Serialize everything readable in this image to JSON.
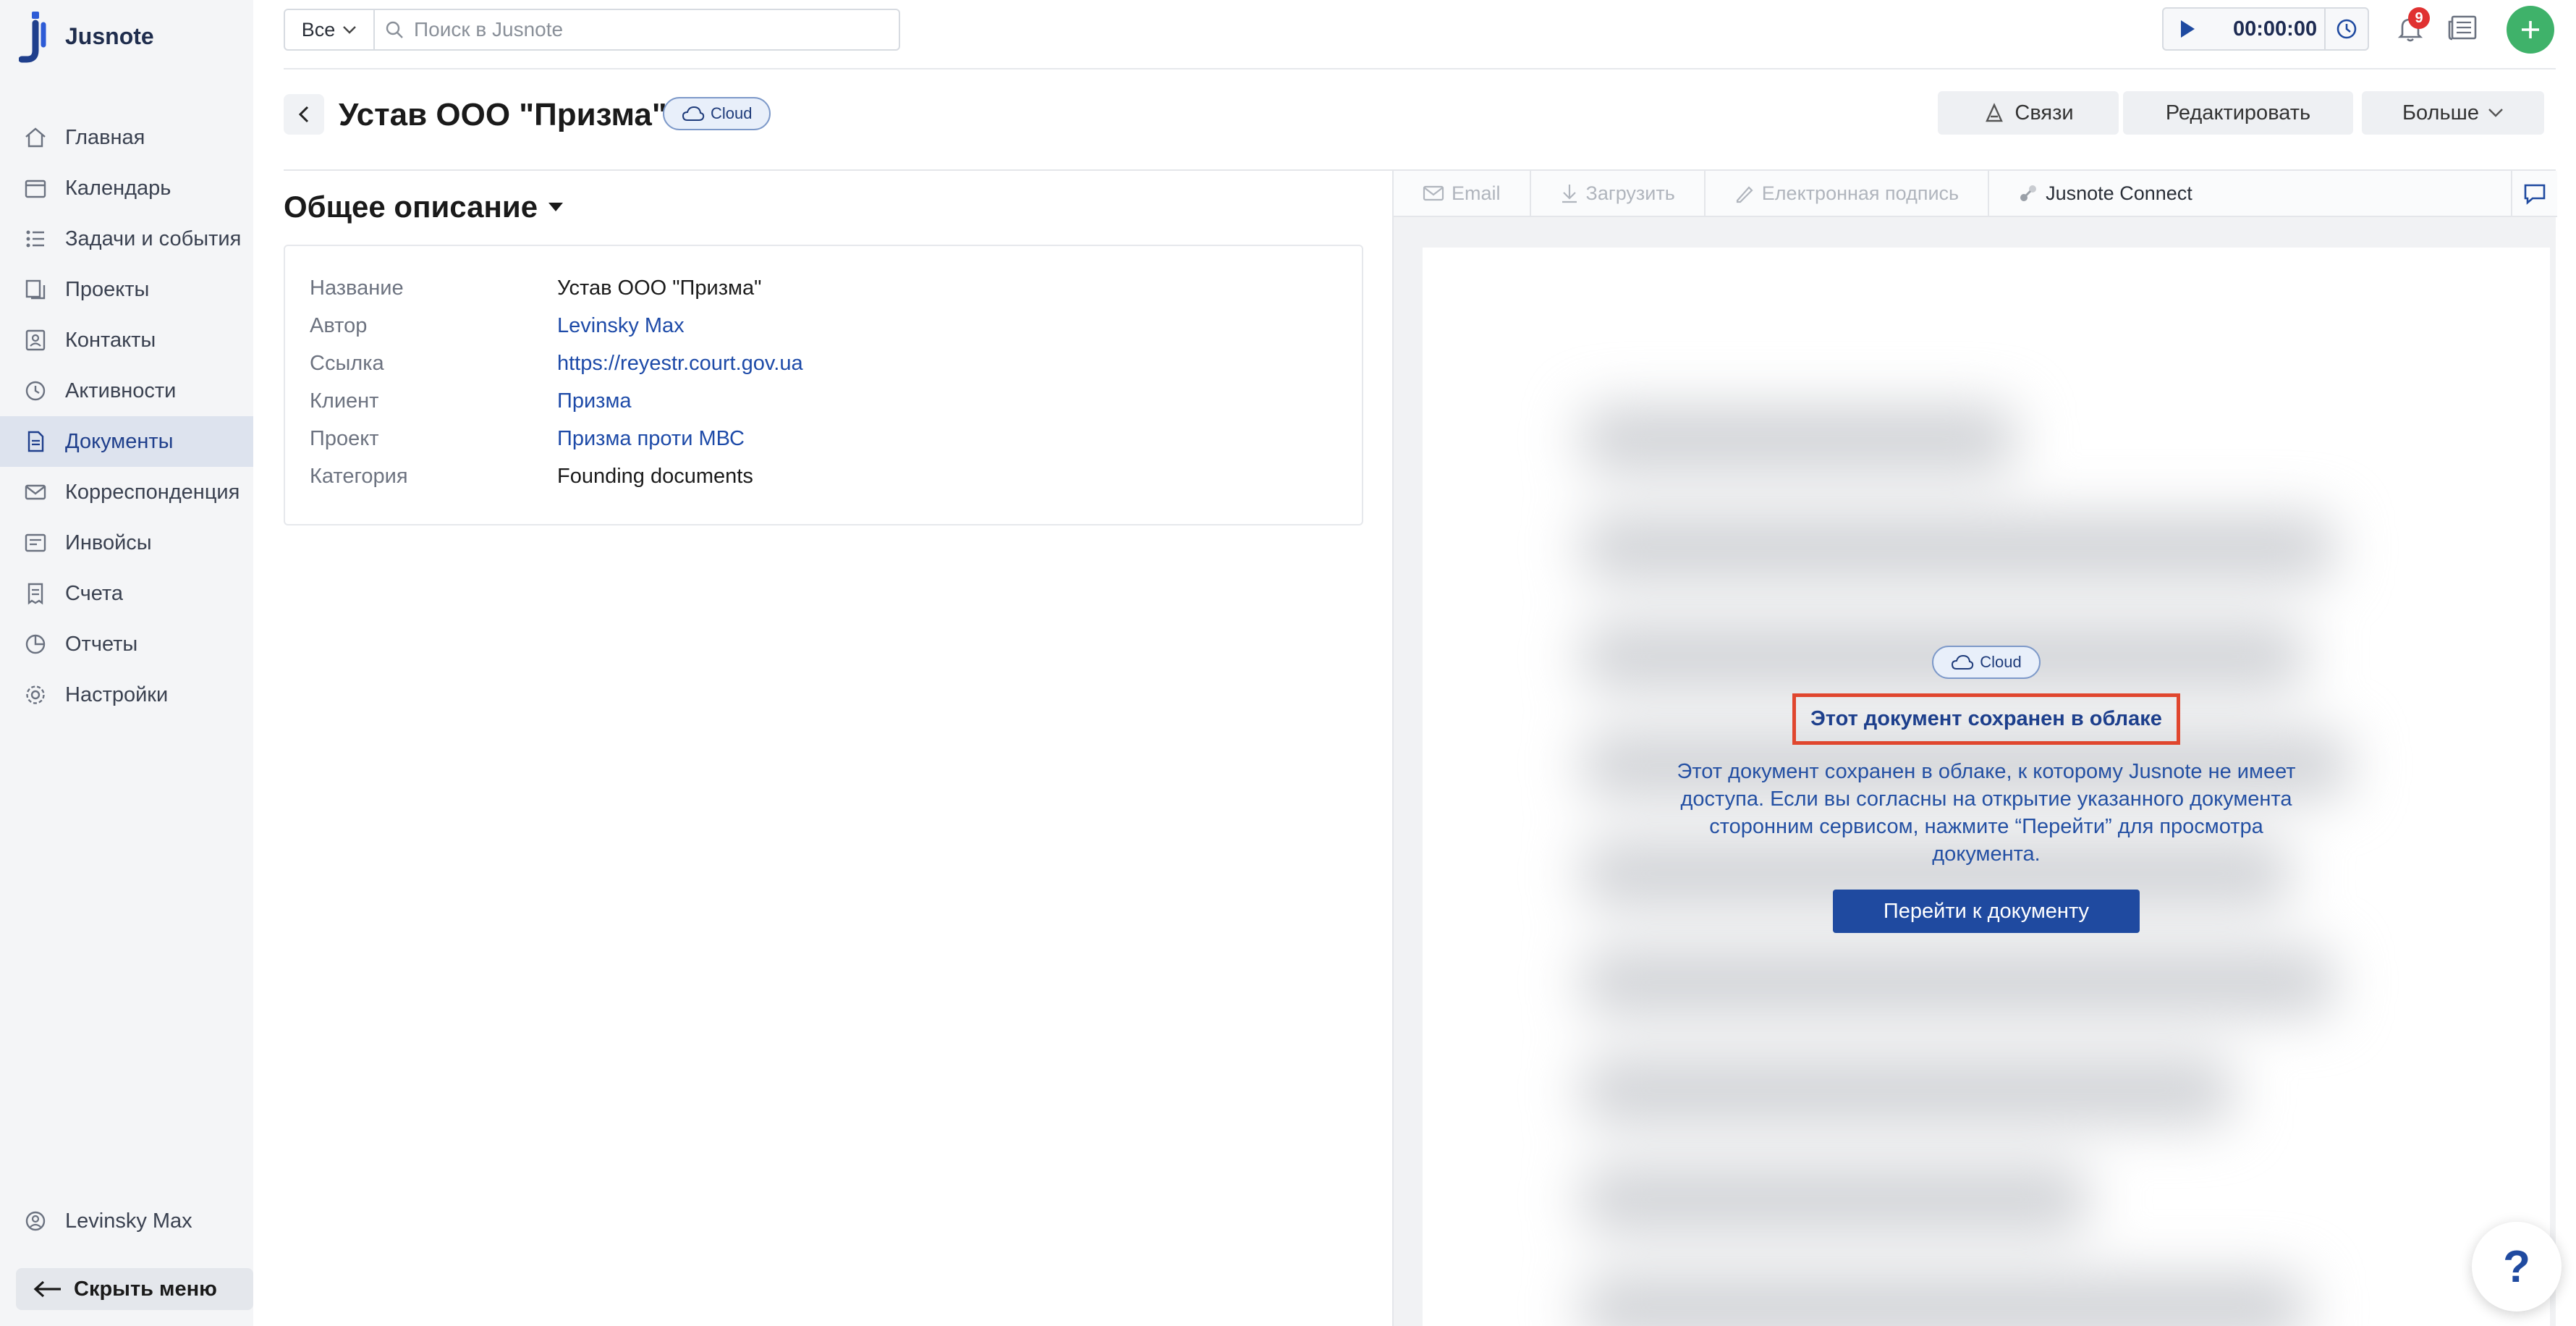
{
  "app": {
    "name": "Jusnote"
  },
  "sidebar": {
    "items": [
      {
        "label": "Главная",
        "icon": "home-icon"
      },
      {
        "label": "Календарь",
        "icon": "calendar-icon"
      },
      {
        "label": "Задачи и события",
        "icon": "tasks-icon"
      },
      {
        "label": "Проекты",
        "icon": "projects-icon"
      },
      {
        "label": "Контакты",
        "icon": "contacts-icon"
      },
      {
        "label": "Активности",
        "icon": "activity-icon"
      },
      {
        "label": "Документы",
        "icon": "documents-icon",
        "active": true
      },
      {
        "label": "Корреспонденция",
        "icon": "correspondence-icon"
      },
      {
        "label": "Инвойсы",
        "icon": "invoices-icon"
      },
      {
        "label": "Счета",
        "icon": "bills-icon"
      },
      {
        "label": "Отчеты",
        "icon": "reports-icon"
      },
      {
        "label": "Настройки",
        "icon": "settings-icon"
      }
    ],
    "user": "Levinsky Max",
    "hide_menu": "Скрыть меню"
  },
  "topbar": {
    "scope": "Все",
    "search_placeholder": "Поиск в Jusnote",
    "timer": "00:00:00",
    "notifications_count": "9"
  },
  "document": {
    "title": "Устав ООО \"Призма\"",
    "storage_badge": "Cloud",
    "actions": {
      "links": "Связи",
      "edit": "Редактировать",
      "more": "Больше"
    }
  },
  "details": {
    "section_title": "Общее описание",
    "rows": [
      {
        "label": "Название",
        "value": "Устав ООО \"Призма\""
      },
      {
        "label": "Автор",
        "value": "Levinsky Max"
      },
      {
        "label": "Ссылка",
        "value": "https://reyestr.court.gov.ua"
      },
      {
        "label": "Клиент",
        "value": "Призма"
      },
      {
        "label": "Проект",
        "value": "Призма проти МВС"
      },
      {
        "label": "Категория",
        "value": "Founding documents"
      }
    ]
  },
  "viewer": {
    "toolbar": {
      "email": "Email",
      "download": "Загрузить",
      "signature": "Електронная подпись",
      "connect": "Jusnote Connect"
    },
    "badge": "Cloud",
    "notice_title": "Этот документ сохранен в облаке",
    "notice_text": "Этот документ сохранен в облаке, к которому Jusnote не имеет доступа. Если вы согласны на открытие указанного документа сторонним сервисом, нажмите “Перейти” для просмотра документа.",
    "go_button": "Перейти к документу"
  },
  "help": {
    "label": "?"
  },
  "colors": {
    "accent": "#1f4aa0",
    "active_nav_bg": "#dde3ee",
    "plus_green": "#3fb26a",
    "badge_red": "#e03131",
    "highlight": "#e0462e"
  }
}
